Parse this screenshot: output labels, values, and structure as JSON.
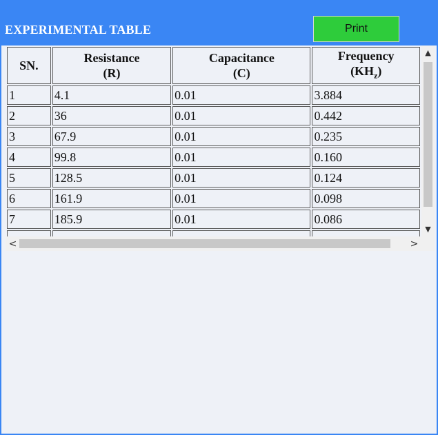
{
  "header": {
    "title": "EXPERIMENTAL TABLE",
    "print_label": "Print"
  },
  "table": {
    "headers": {
      "sn": "SN.",
      "resistance_line1": "Resistance",
      "resistance_line2": "(R)",
      "capacitance_line1": "Capacitance",
      "capacitance_line2": "(C)",
      "frequency_line1": "Frequency",
      "frequency_line2_base": "(KH",
      "frequency_line2_sub": "z",
      "frequency_line2_end": ")"
    },
    "rows": [
      {
        "sn": "1",
        "r": "4.1",
        "c": "0.01",
        "f": "3.884"
      },
      {
        "sn": "2",
        "r": "36",
        "c": "0.01",
        "f": "0.442"
      },
      {
        "sn": "3",
        "r": "67.9",
        "c": "0.01",
        "f": "0.235"
      },
      {
        "sn": "4",
        "r": "99.8",
        "c": "0.01",
        "f": "0.160"
      },
      {
        "sn": "5",
        "r": "128.5",
        "c": "0.01",
        "f": "0.124"
      },
      {
        "sn": "6",
        "r": "161.9",
        "c": "0.01",
        "f": "0.098"
      },
      {
        "sn": "7",
        "r": "185.9",
        "c": "0.01",
        "f": "0.086"
      }
    ]
  },
  "scrollbars": {
    "up_icon": "▲",
    "down_icon": "▼",
    "left_icon": "<",
    "right_icon": ">"
  },
  "colors": {
    "header_bg": "#3a86f4",
    "print_button_bg": "#2ecc3b",
    "panel_bg": "#eef1f7"
  }
}
